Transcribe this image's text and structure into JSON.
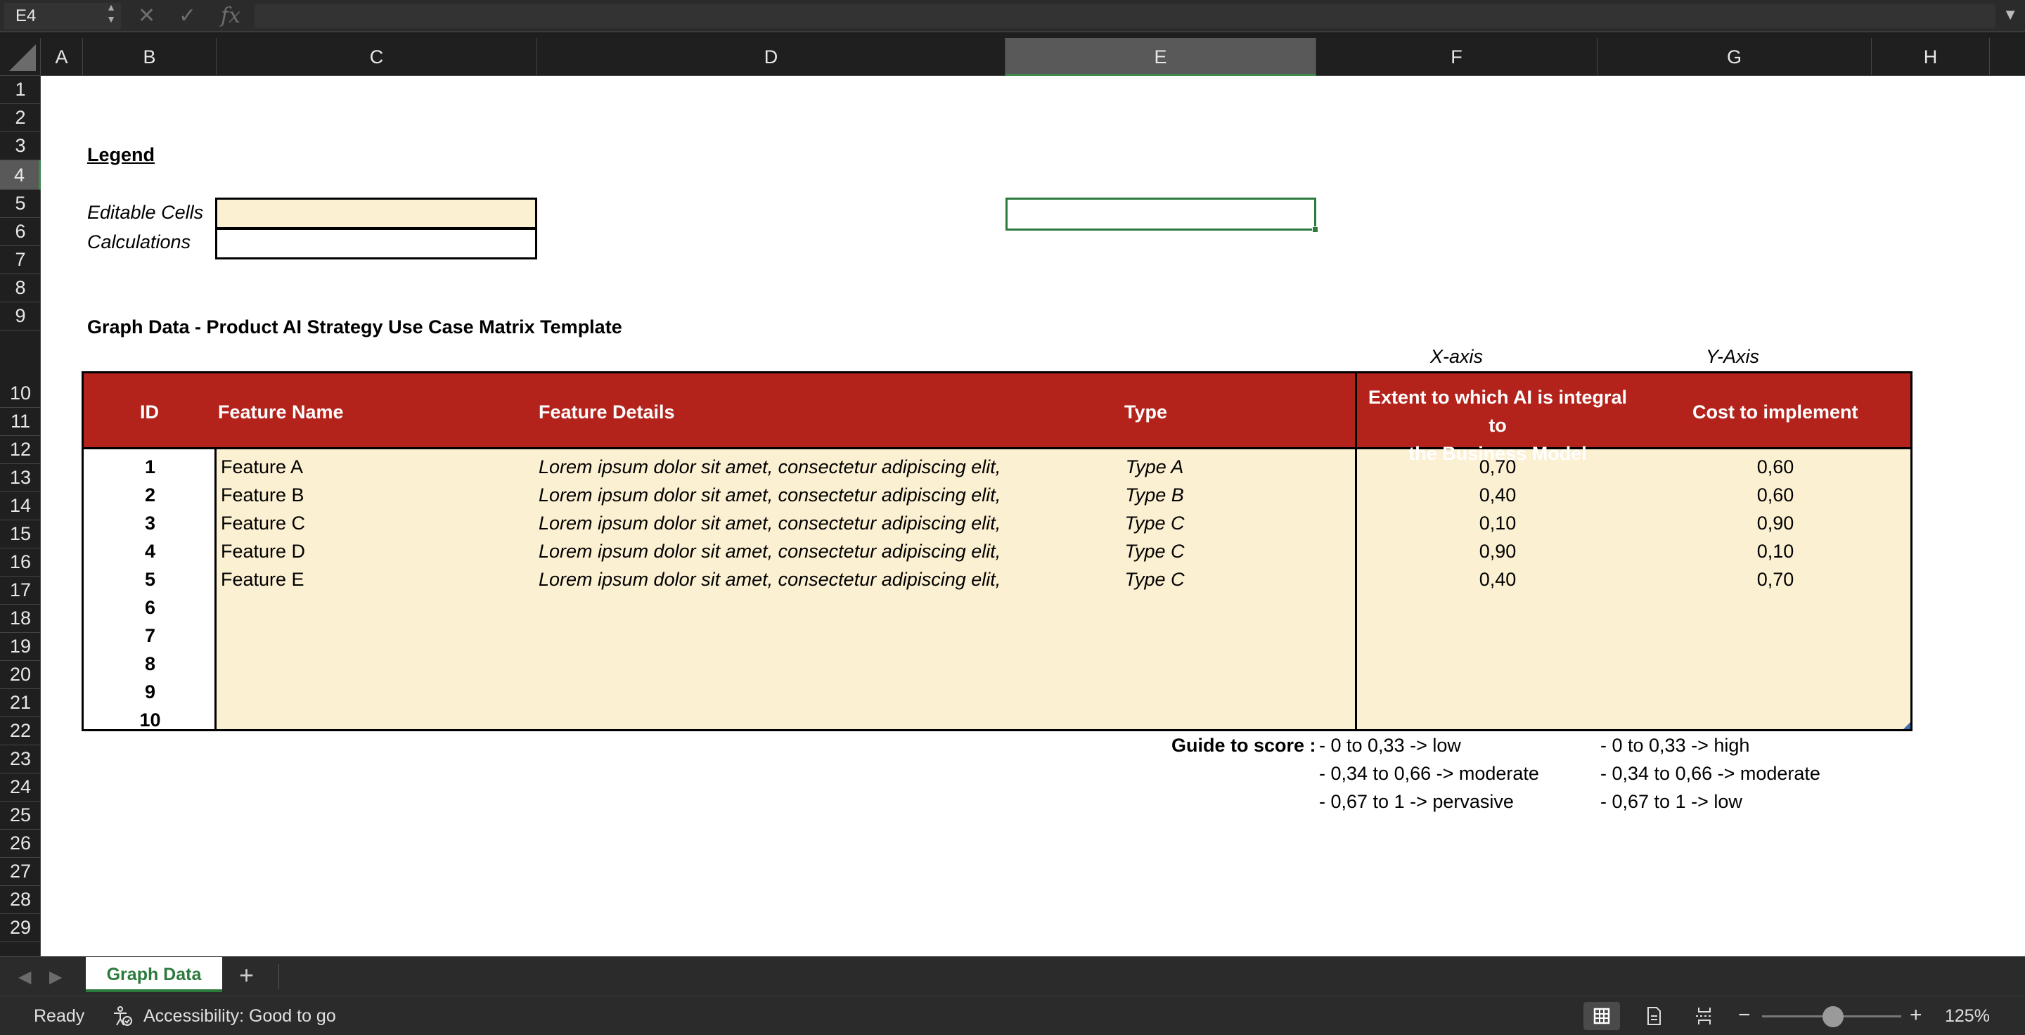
{
  "formula_bar": {
    "name_box": "E4",
    "cancel_icon": "close-icon",
    "enter_icon": "checkmark-icon",
    "function_label": "fx",
    "formula": ""
  },
  "columns": [
    "A",
    "B",
    "C",
    "D",
    "E",
    "F",
    "G",
    "H"
  ],
  "selected_column": "E",
  "rows": [
    "1",
    "2",
    "3",
    "4",
    "5",
    "6",
    "7",
    "8",
    "9",
    "10",
    "11",
    "12",
    "13",
    "14",
    "15",
    "16",
    "17",
    "18",
    "19",
    "20",
    "21",
    "22",
    "23",
    "24",
    "25",
    "26",
    "27",
    "28",
    "29"
  ],
  "selected_row": "4",
  "legend": {
    "title": "Legend",
    "editable_label": "Editable Cells",
    "calculations_label": "Calculations",
    "editable_color": "#fcf0d2",
    "calculations_color": "#ffffff"
  },
  "section_title": "Graph Data - Product AI Strategy Use Case Matrix Template",
  "axis_labels": {
    "x": "X-axis",
    "y": "Y-Axis"
  },
  "table": {
    "header_color": "#b3221b",
    "headers": {
      "id": "ID",
      "name": "Feature Name",
      "details": "Feature Details",
      "type": "Type",
      "x_line1": "Extent to which AI is integral to",
      "x_line2": "the Business Model",
      "y": "Cost to implement"
    },
    "rows": [
      {
        "id": "1",
        "name": "Feature A",
        "details": "Lorem ipsum dolor sit amet, consectetur adipiscing elit,",
        "type": "Type A",
        "x": "0,70",
        "y": "0,60"
      },
      {
        "id": "2",
        "name": "Feature B",
        "details": "Lorem ipsum dolor sit amet, consectetur adipiscing elit,",
        "type": "Type B",
        "x": "0,40",
        "y": "0,60"
      },
      {
        "id": "3",
        "name": "Feature C",
        "details": "Lorem ipsum dolor sit amet, consectetur adipiscing elit,",
        "type": "Type C",
        "x": "0,10",
        "y": "0,90"
      },
      {
        "id": "4",
        "name": "Feature D",
        "details": "Lorem ipsum dolor sit amet, consectetur adipiscing elit,",
        "type": "Type C",
        "x": "0,90",
        "y": "0,10"
      },
      {
        "id": "5",
        "name": "Feature E",
        "details": "Lorem ipsum dolor sit amet, consectetur adipiscing elit,",
        "type": "Type C",
        "x": "0,40",
        "y": "0,70"
      },
      {
        "id": "6",
        "name": "",
        "details": "",
        "type": "",
        "x": "",
        "y": ""
      },
      {
        "id": "7",
        "name": "",
        "details": "",
        "type": "",
        "x": "",
        "y": ""
      },
      {
        "id": "8",
        "name": "",
        "details": "",
        "type": "",
        "x": "",
        "y": ""
      },
      {
        "id": "9",
        "name": "",
        "details": "",
        "type": "",
        "x": "",
        "y": ""
      },
      {
        "id": "10",
        "name": "",
        "details": "",
        "type": "",
        "x": "",
        "y": ""
      }
    ]
  },
  "guide": {
    "label": "Guide to score :",
    "x": [
      "- 0 to 0,33 -> low",
      "- 0,34 to 0,66 -> moderate",
      "- 0,67 to 1 -> pervasive"
    ],
    "y": [
      "- 0 to 0,33 -> high",
      "- 0,34 to 0,66 -> moderate",
      "- 0,67 to 1 -> low"
    ]
  },
  "tabs": {
    "active": "Graph Data",
    "add_icon": "plus-icon"
  },
  "status": {
    "ready": "Ready",
    "accessibility": "Accessibility: Good to go",
    "zoom": "125%",
    "zoom_level_percent": 125
  }
}
